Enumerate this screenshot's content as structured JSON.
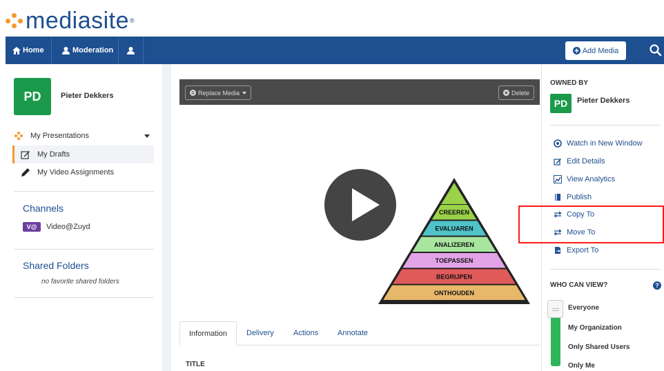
{
  "brand": {
    "name": "mediasite",
    "tm": "®"
  },
  "nav": {
    "home": "Home",
    "moderation": "Moderation",
    "add_media": "Add Media"
  },
  "user": {
    "initials": "PD",
    "name": "Pieter Dekkers"
  },
  "sidebar": {
    "items": [
      {
        "label": "My Presentations"
      },
      {
        "label": "My Drafts"
      },
      {
        "label": "My Video Assignments"
      }
    ],
    "channels_title": "Channels",
    "channel": {
      "badge": "V@",
      "label": "Video@Zuyd"
    },
    "shared_title": "Shared Folders",
    "shared_empty": "no favorite shared folders"
  },
  "player": {
    "replace_media": "Replace Media",
    "delete": "Delete",
    "pyramid_levels": [
      "CREEREN",
      "EVALUAREN",
      "ANALIZEREN",
      "TOEPASSEN",
      "BEGRIJPEN",
      "ONTHOUDEN"
    ],
    "pyramid_colors": [
      "#9bd24a",
      "#4fc3c8",
      "#a8e6a0",
      "#e2a4e6",
      "#e05a5a",
      "#e8b86a"
    ]
  },
  "tabs": [
    "Information",
    "Delivery",
    "Actions",
    "Annotate"
  ],
  "info": {
    "title_label": "TITLE"
  },
  "right": {
    "owned_by": "OWNED BY",
    "owner_initials": "PD",
    "owner_name": "Pieter Dekkers",
    "actions": [
      {
        "label": "Watch in New Window",
        "icon": "play-circle-icon"
      },
      {
        "label": "Edit Details",
        "icon": "edit-icon"
      },
      {
        "label": "View Analytics",
        "icon": "analytics-icon"
      },
      {
        "label": "Publish",
        "icon": "publish-icon"
      },
      {
        "label": "Copy To",
        "icon": "copy-arrows-icon"
      },
      {
        "label": "Move To",
        "icon": "move-arrows-icon"
      },
      {
        "label": "Export To",
        "icon": "export-icon"
      }
    ],
    "who_can_view": "WHO CAN VIEW?",
    "help": "?",
    "visibility_options": [
      "Everyone",
      "My Organization",
      "Only Shared Users",
      "Only Me"
    ]
  },
  "colors": {
    "brand_blue": "#1d4f91",
    "accent_orange": "#f39a2c",
    "avatar_green": "#1a9a4a",
    "highlight_red": "#ff1a1a"
  }
}
